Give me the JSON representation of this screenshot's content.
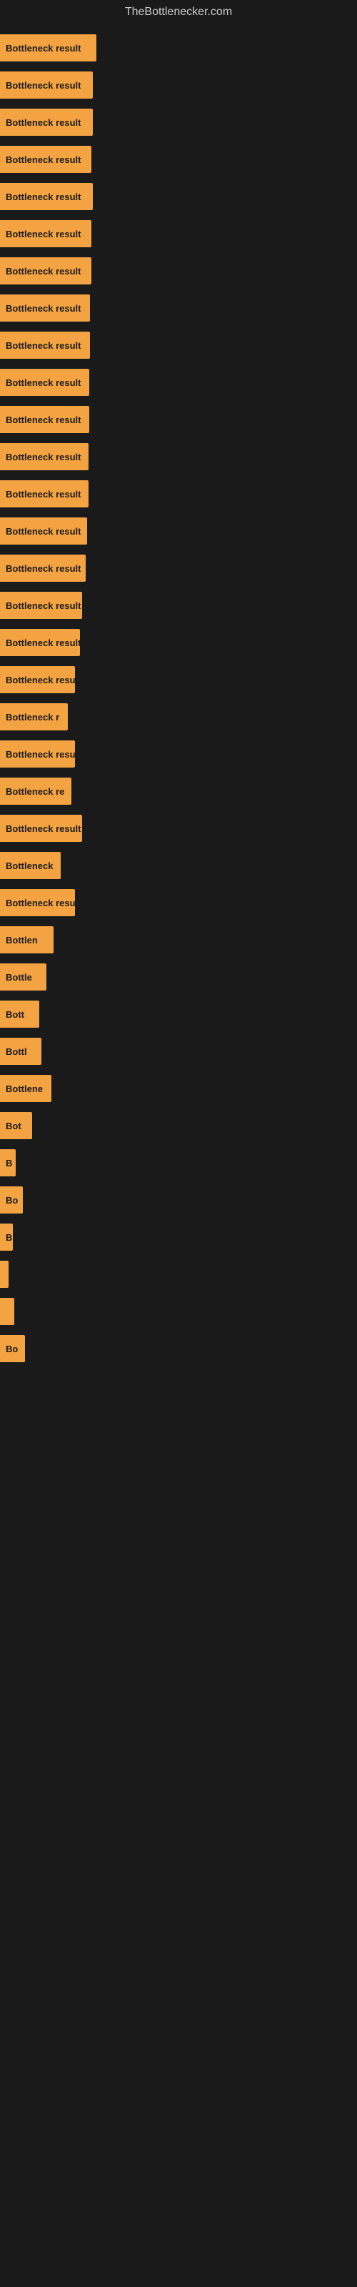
{
  "site": {
    "title": "TheBottlenecker.com"
  },
  "bars": [
    {
      "label": "Bottleneck result",
      "width": 135
    },
    {
      "label": "Bottleneck result",
      "width": 130
    },
    {
      "label": "Bottleneck result",
      "width": 130
    },
    {
      "label": "Bottleneck result",
      "width": 128
    },
    {
      "label": "Bottleneck result",
      "width": 130
    },
    {
      "label": "Bottleneck result",
      "width": 128
    },
    {
      "label": "Bottleneck result",
      "width": 128
    },
    {
      "label": "Bottleneck result",
      "width": 126
    },
    {
      "label": "Bottleneck result",
      "width": 126
    },
    {
      "label": "Bottleneck result",
      "width": 125
    },
    {
      "label": "Bottleneck result",
      "width": 125
    },
    {
      "label": "Bottleneck result",
      "width": 124
    },
    {
      "label": "Bottleneck result",
      "width": 124
    },
    {
      "label": "Bottleneck result",
      "width": 122
    },
    {
      "label": "Bottleneck result",
      "width": 120
    },
    {
      "label": "Bottleneck result",
      "width": 115
    },
    {
      "label": "Bottleneck result",
      "width": 112
    },
    {
      "label": "Bottleneck resu",
      "width": 105
    },
    {
      "label": "Bottleneck r",
      "width": 95
    },
    {
      "label": "Bottleneck resu",
      "width": 105
    },
    {
      "label": "Bottleneck re",
      "width": 100
    },
    {
      "label": "Bottleneck result",
      "width": 115
    },
    {
      "label": "Bottleneck",
      "width": 85
    },
    {
      "label": "Bottleneck resu",
      "width": 105
    },
    {
      "label": "Bottlen",
      "width": 75
    },
    {
      "label": "Bottle",
      "width": 65
    },
    {
      "label": "Bott",
      "width": 55
    },
    {
      "label": "Bottl",
      "width": 58
    },
    {
      "label": "Bottlene",
      "width": 72
    },
    {
      "label": "Bot",
      "width": 45
    },
    {
      "label": "B",
      "width": 22
    },
    {
      "label": "Bo",
      "width": 32
    },
    {
      "label": "B",
      "width": 18
    },
    {
      "label": "",
      "width": 12
    },
    {
      "label": "",
      "width": 20
    },
    {
      "label": "Bo",
      "width": 35
    }
  ]
}
